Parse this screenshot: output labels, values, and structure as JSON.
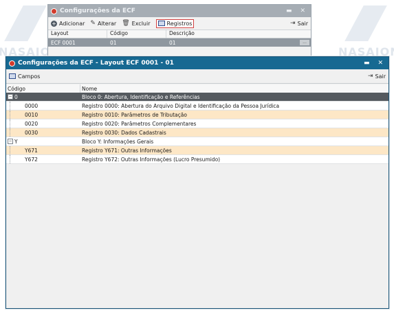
{
  "watermark": "NASAJON",
  "back_window": {
    "title": "Configurações da ECF",
    "toolbar": {
      "add_label": "Adicionar",
      "edit_label": "Alterar",
      "delete_label": "Excluir",
      "registros_label": "Registros",
      "exit_label": "Sair"
    },
    "columns": [
      "Layout",
      "Código",
      "Descrição"
    ],
    "row": {
      "layout": "ECF 0001",
      "codigo": "01",
      "descricao": "01",
      "more": "..."
    }
  },
  "front_window": {
    "title": "Configurações da ECF - Layout ECF 0001 - 01",
    "toolbar": {
      "campos_label": "Campos",
      "exit_label": "Sair"
    },
    "columns": {
      "codigo": "Código",
      "nome": "Nome"
    },
    "rows": [
      {
        "code": "0",
        "name": "Bloco 0: Abertura, Identificação e Referências",
        "toggle": "−"
      },
      {
        "code": "0000",
        "name": "Registro 0000: Abertura do Arquivo Digital e Identificação da Pessoa Jurídica"
      },
      {
        "code": "0010",
        "name": "Registro 0010: Parâmetros de Tributação"
      },
      {
        "code": "0020",
        "name": "Registro 0020: Parâmetros Complementares"
      },
      {
        "code": "0030",
        "name": "Registro 0030: Dados Cadastrais"
      },
      {
        "code": "Y",
        "name": "Bloco Y: Informações Gerais",
        "toggle": "−"
      },
      {
        "code": "Y671",
        "name": "Registro Y671: Outras Informações"
      },
      {
        "code": "Y672",
        "name": "Registro Y672: Outras Informações (Lucro Presumido)"
      }
    ]
  },
  "colors": {
    "front_title_bg": "#176992",
    "back_title_bg": "#a6adb4",
    "selected_row": "#555a5f",
    "highlight_row": "#fde7c6"
  }
}
